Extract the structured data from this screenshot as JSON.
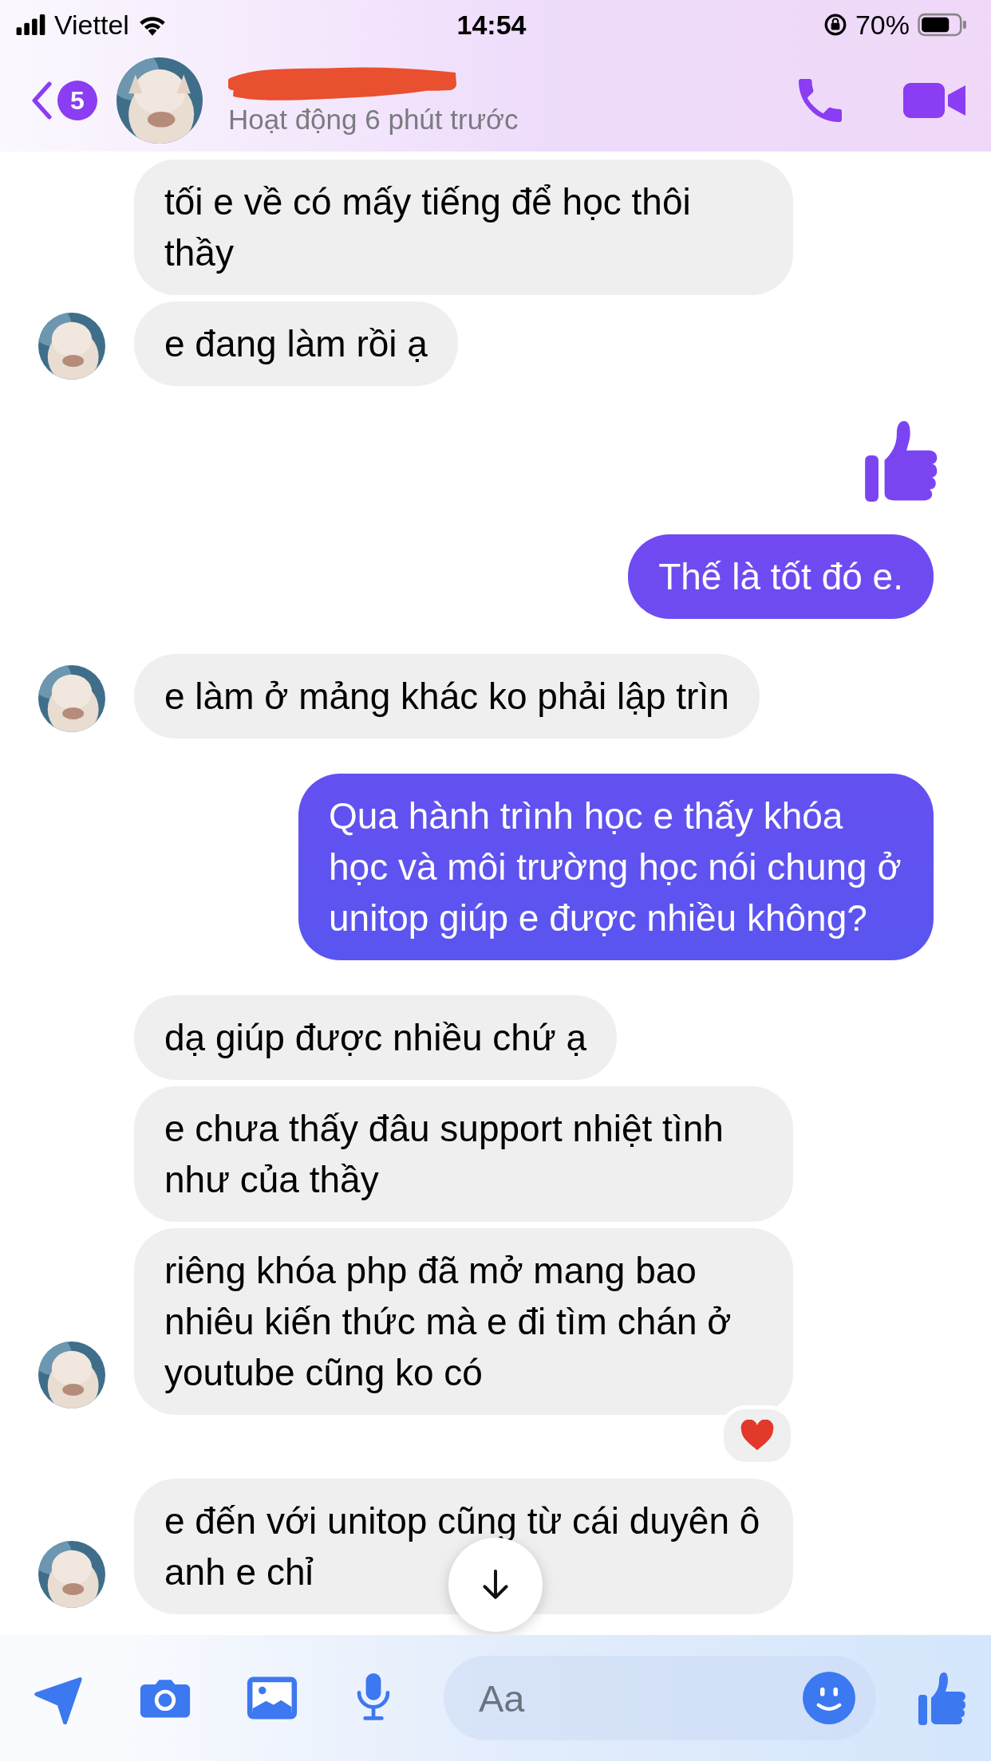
{
  "status_bar": {
    "carrier": "Viettel",
    "time": "14:54",
    "battery": "70%"
  },
  "header": {
    "back_badge": "5",
    "subtitle": "Hoạt động 6 phút trước"
  },
  "messages": [
    {
      "outgoing": false,
      "kind": "text",
      "text": "tối e về có mấy tiếng để học thôi thầy",
      "avatar": false,
      "reaction": false
    },
    {
      "outgoing": false,
      "kind": "text",
      "text": "e đang làm rồi ạ",
      "avatar": true,
      "reaction": false
    },
    {
      "outgoing": true,
      "kind": "like"
    },
    {
      "outgoing": true,
      "kind": "text",
      "text": "Thế là tốt đó e."
    },
    {
      "outgoing": false,
      "kind": "text",
      "text": "e làm ở mảng khác ko phải lập trìn",
      "avatar": true,
      "reaction": false
    },
    {
      "outgoing": true,
      "kind": "text",
      "text": "Qua hành trình học e thấy khóa học và môi trường học nói chung ở unitop giúp e được nhiều không?"
    },
    {
      "outgoing": false,
      "kind": "text",
      "text": "dạ giúp được nhiều chứ ạ",
      "avatar": false,
      "reaction": false
    },
    {
      "outgoing": false,
      "kind": "text",
      "text": "e chưa thấy đâu support nhiệt tình như của thầy",
      "avatar": false,
      "reaction": false
    },
    {
      "outgoing": false,
      "kind": "text",
      "text": "riêng khóa php đã mở mang bao nhiêu kiến thức mà e đi tìm chán ở youtube cũng ko có",
      "avatar": true,
      "reaction": true
    },
    {
      "outgoing": false,
      "kind": "text",
      "text": "e đến với unitop cũng từ cái duyên ô anh e chỉ",
      "avatar": true,
      "reaction": false
    }
  ],
  "composer": {
    "placeholder": "Aa"
  }
}
